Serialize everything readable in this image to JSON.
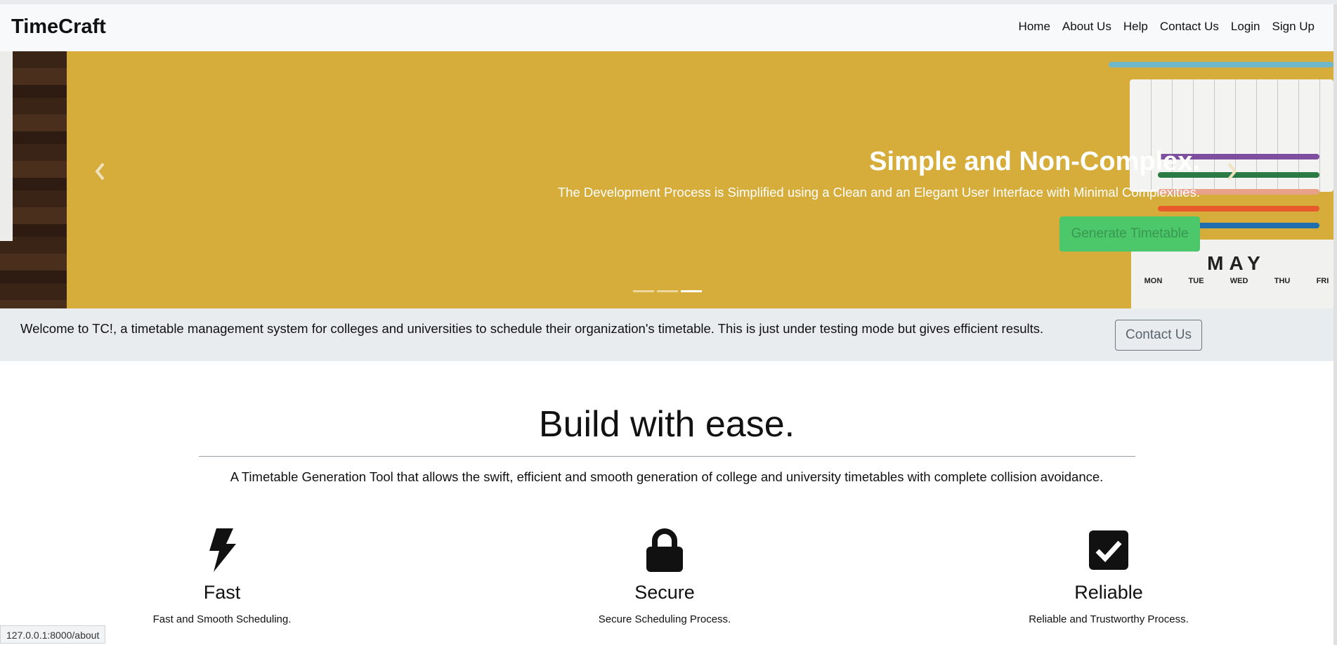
{
  "navbar": {
    "brand": "TimeCraft",
    "links": [
      "Home",
      "About Us",
      "Help",
      "Contact Us",
      "Login",
      "Sign Up"
    ]
  },
  "hero": {
    "title": "Simple and Non-Complex.",
    "subtitle": "The Development Process is Simplified using a Clean and an Elegant User Interface with Minimal Complexities.",
    "button_label": "Generate Timetable",
    "prev_icon": "chevron-left-icon",
    "next_icon": "chevron-right-icon",
    "slides_count": 3,
    "active_slide": 3,
    "calendar_month": "MAY",
    "calendar_days": [
      "MON",
      "TUE",
      "WED",
      "THU",
      "FRI"
    ],
    "colors": {
      "background": "#d6ac3a",
      "button": "#4cc76a"
    }
  },
  "welcome": {
    "text": "Welcome to TC!, a timetable management system for colleges and universities to schedule their organization's timetable. This is just under testing mode but gives efficient results.",
    "button_label": "Contact Us"
  },
  "about": {
    "title": "Build with ease.",
    "subtitle": "A Timetable Generation Tool that allows the swift, efficient and smooth generation of college and university timetables with complete collision avoidance."
  },
  "features": [
    {
      "icon": "lightning-bolt-icon",
      "title": "Fast",
      "description": "Fast and Smooth Scheduling."
    },
    {
      "icon": "lock-icon",
      "title": "Secure",
      "description": "Secure Scheduling Process."
    },
    {
      "icon": "checkbox-icon",
      "title": "Reliable",
      "description": "Reliable and Trustworthy Process."
    }
  ],
  "status_bar": {
    "url": "127.0.0.1:8000/about"
  }
}
